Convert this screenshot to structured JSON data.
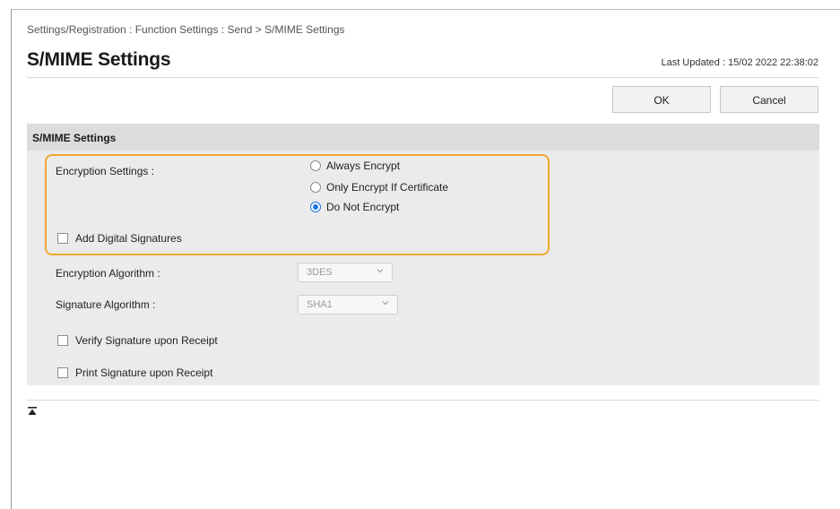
{
  "breadcrumb": "Settings/Registration : Function Settings : Send > S/MIME Settings",
  "page": {
    "title": "S/MIME Settings",
    "last_updated": "Last Updated : 15/02 2022 22:38:02"
  },
  "buttons": {
    "ok": "OK",
    "cancel": "Cancel"
  },
  "panel": {
    "header": "S/MIME Settings",
    "encryption_settings": {
      "label": "Encryption Settings :",
      "options": [
        {
          "label": "Always Encrypt",
          "checked": false
        },
        {
          "label": "Only Encrypt If Certificate",
          "checked": false
        },
        {
          "label": "Do Not Encrypt",
          "checked": true
        }
      ]
    },
    "add_digital_signatures": {
      "label": "Add Digital Signatures",
      "checked": false
    },
    "encryption_algorithm": {
      "label": "Encryption Algorithm :",
      "value": "3DES"
    },
    "signature_algorithm": {
      "label": "Signature Algorithm :",
      "value": "SHA1"
    },
    "verify_signature": {
      "label": "Verify Signature upon Receipt",
      "checked": false
    },
    "print_signature": {
      "label": "Print Signature upon Receipt",
      "checked": false
    }
  },
  "icons": {
    "select_chevron": "chevron-down-icon",
    "back_to_top": "back-to-top-icon"
  },
  "colors": {
    "highlight": "#f0a830",
    "radio_selected": "#1e73e8"
  }
}
